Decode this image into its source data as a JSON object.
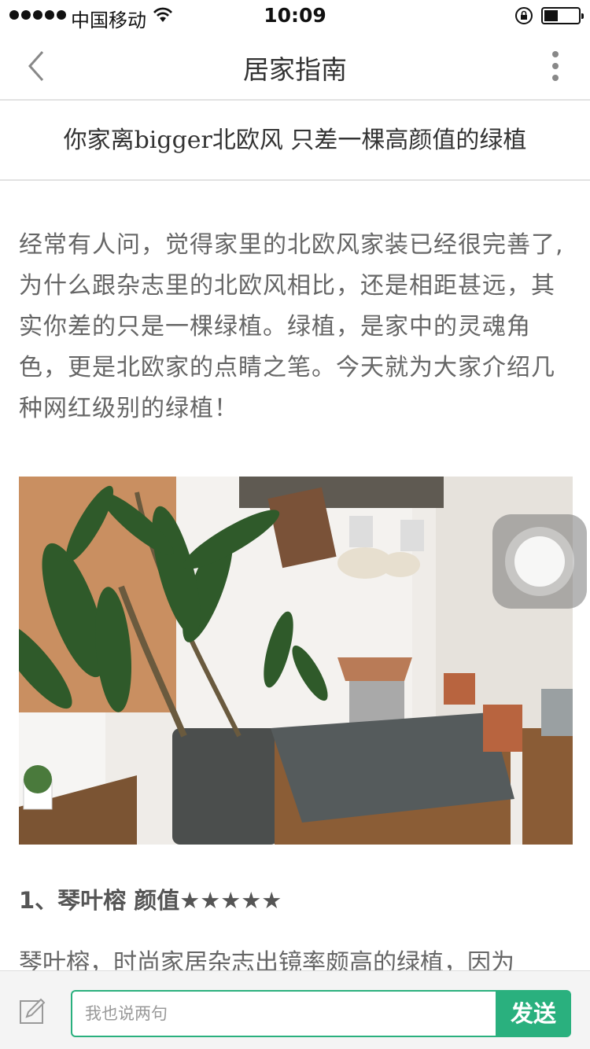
{
  "status_bar": {
    "carrier": "中国移动",
    "time": "10:09",
    "battery_level": 0.4,
    "icons": [
      "signal-dots",
      "wifi-icon",
      "rotation-lock-icon",
      "battery-icon"
    ]
  },
  "nav": {
    "title": "居家指南",
    "back_icon": "chevron-left-icon",
    "more_icon": "more-vertical-icon"
  },
  "article": {
    "title": "你家离bigger北欧风 只差一棵高颜值的绿植",
    "intro": "经常有人问，觉得家里的北欧风家装已经很完善了,为什么跟杂志里的北欧风相比，还是相距甚远，其实你差的只是一棵绿植。绿植，是家中的灵魂角色，更是北欧家的点睛之笔。今天就为大家介绍几种网红级别的绿植！",
    "image_alt": "photo",
    "section_heading": "1、琴叶榕  颜值★★★★★",
    "section_text": "琴叶榕，时尚家居杂志出镜率颇高的绿植，因为"
  },
  "comment_bar": {
    "placeholder": "我也说两句",
    "send_label": "发送",
    "accent_color": "#2ab07e"
  }
}
